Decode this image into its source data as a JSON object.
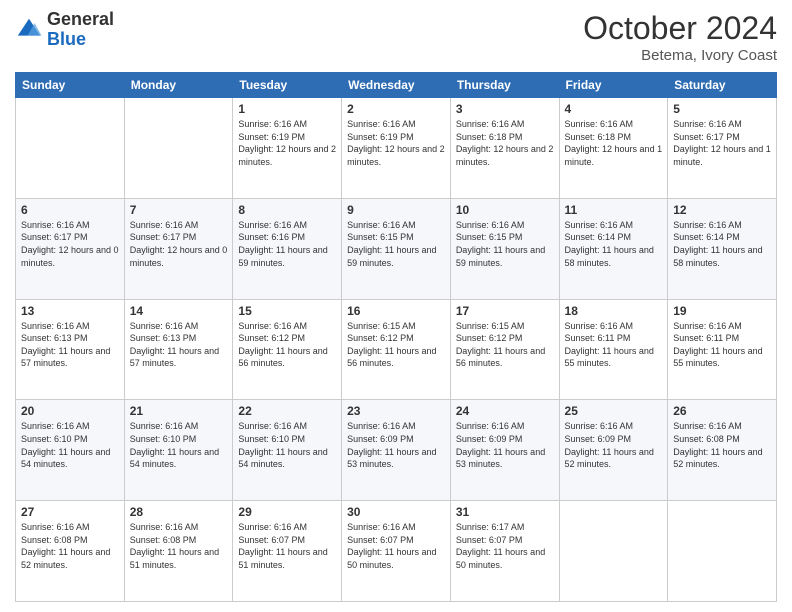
{
  "header": {
    "logo_general": "General",
    "logo_blue": "Blue",
    "month_title": "October 2024",
    "subtitle": "Betema, Ivory Coast"
  },
  "weekdays": [
    "Sunday",
    "Monday",
    "Tuesday",
    "Wednesday",
    "Thursday",
    "Friday",
    "Saturday"
  ],
  "weeks": [
    [
      {
        "day": "",
        "info": ""
      },
      {
        "day": "",
        "info": ""
      },
      {
        "day": "1",
        "info": "Sunrise: 6:16 AM\nSunset: 6:19 PM\nDaylight: 12 hours\nand 2 minutes."
      },
      {
        "day": "2",
        "info": "Sunrise: 6:16 AM\nSunset: 6:19 PM\nDaylight: 12 hours\nand 2 minutes."
      },
      {
        "day": "3",
        "info": "Sunrise: 6:16 AM\nSunset: 6:18 PM\nDaylight: 12 hours\nand 2 minutes."
      },
      {
        "day": "4",
        "info": "Sunrise: 6:16 AM\nSunset: 6:18 PM\nDaylight: 12 hours\nand 1 minute."
      },
      {
        "day": "5",
        "info": "Sunrise: 6:16 AM\nSunset: 6:17 PM\nDaylight: 12 hours\nand 1 minute."
      }
    ],
    [
      {
        "day": "6",
        "info": "Sunrise: 6:16 AM\nSunset: 6:17 PM\nDaylight: 12 hours\nand 0 minutes."
      },
      {
        "day": "7",
        "info": "Sunrise: 6:16 AM\nSunset: 6:17 PM\nDaylight: 12 hours\nand 0 minutes."
      },
      {
        "day": "8",
        "info": "Sunrise: 6:16 AM\nSunset: 6:16 PM\nDaylight: 11 hours\nand 59 minutes."
      },
      {
        "day": "9",
        "info": "Sunrise: 6:16 AM\nSunset: 6:15 PM\nDaylight: 11 hours\nand 59 minutes."
      },
      {
        "day": "10",
        "info": "Sunrise: 6:16 AM\nSunset: 6:15 PM\nDaylight: 11 hours\nand 59 minutes."
      },
      {
        "day": "11",
        "info": "Sunrise: 6:16 AM\nSunset: 6:14 PM\nDaylight: 11 hours\nand 58 minutes."
      },
      {
        "day": "12",
        "info": "Sunrise: 6:16 AM\nSunset: 6:14 PM\nDaylight: 11 hours\nand 58 minutes."
      }
    ],
    [
      {
        "day": "13",
        "info": "Sunrise: 6:16 AM\nSunset: 6:13 PM\nDaylight: 11 hours\nand 57 minutes."
      },
      {
        "day": "14",
        "info": "Sunrise: 6:16 AM\nSunset: 6:13 PM\nDaylight: 11 hours\nand 57 minutes."
      },
      {
        "day": "15",
        "info": "Sunrise: 6:16 AM\nSunset: 6:12 PM\nDaylight: 11 hours\nand 56 minutes."
      },
      {
        "day": "16",
        "info": "Sunrise: 6:15 AM\nSunset: 6:12 PM\nDaylight: 11 hours\nand 56 minutes."
      },
      {
        "day": "17",
        "info": "Sunrise: 6:15 AM\nSunset: 6:12 PM\nDaylight: 11 hours\nand 56 minutes."
      },
      {
        "day": "18",
        "info": "Sunrise: 6:16 AM\nSunset: 6:11 PM\nDaylight: 11 hours\nand 55 minutes."
      },
      {
        "day": "19",
        "info": "Sunrise: 6:16 AM\nSunset: 6:11 PM\nDaylight: 11 hours\nand 55 minutes."
      }
    ],
    [
      {
        "day": "20",
        "info": "Sunrise: 6:16 AM\nSunset: 6:10 PM\nDaylight: 11 hours\nand 54 minutes."
      },
      {
        "day": "21",
        "info": "Sunrise: 6:16 AM\nSunset: 6:10 PM\nDaylight: 11 hours\nand 54 minutes."
      },
      {
        "day": "22",
        "info": "Sunrise: 6:16 AM\nSunset: 6:10 PM\nDaylight: 11 hours\nand 54 minutes."
      },
      {
        "day": "23",
        "info": "Sunrise: 6:16 AM\nSunset: 6:09 PM\nDaylight: 11 hours\nand 53 minutes."
      },
      {
        "day": "24",
        "info": "Sunrise: 6:16 AM\nSunset: 6:09 PM\nDaylight: 11 hours\nand 53 minutes."
      },
      {
        "day": "25",
        "info": "Sunrise: 6:16 AM\nSunset: 6:09 PM\nDaylight: 11 hours\nand 52 minutes."
      },
      {
        "day": "26",
        "info": "Sunrise: 6:16 AM\nSunset: 6:08 PM\nDaylight: 11 hours\nand 52 minutes."
      }
    ],
    [
      {
        "day": "27",
        "info": "Sunrise: 6:16 AM\nSunset: 6:08 PM\nDaylight: 11 hours\nand 52 minutes."
      },
      {
        "day": "28",
        "info": "Sunrise: 6:16 AM\nSunset: 6:08 PM\nDaylight: 11 hours\nand 51 minutes."
      },
      {
        "day": "29",
        "info": "Sunrise: 6:16 AM\nSunset: 6:07 PM\nDaylight: 11 hours\nand 51 minutes."
      },
      {
        "day": "30",
        "info": "Sunrise: 6:16 AM\nSunset: 6:07 PM\nDaylight: 11 hours\nand 50 minutes."
      },
      {
        "day": "31",
        "info": "Sunrise: 6:17 AM\nSunset: 6:07 PM\nDaylight: 11 hours\nand 50 minutes."
      },
      {
        "day": "",
        "info": ""
      },
      {
        "day": "",
        "info": ""
      }
    ]
  ]
}
